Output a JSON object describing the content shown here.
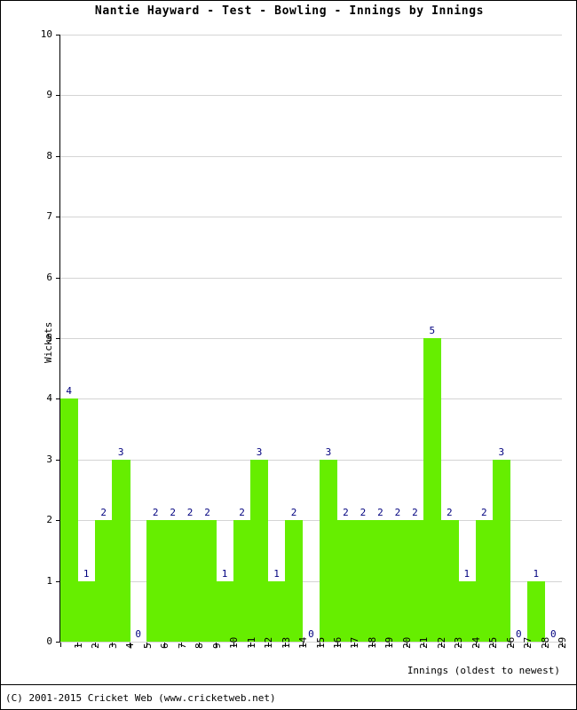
{
  "title": "Nantie Hayward - Test - Bowling - Innings by Innings",
  "footer": "(C) 2001-2015 Cricket Web (www.cricketweb.net)",
  "axes": {
    "x_title": "Innings (oldest to newest)",
    "y_title": "Wickets"
  },
  "colors": {
    "bar": "#66ee00",
    "value_label": "#00007f",
    "gridline": "#d4d4d4",
    "axis": "#000000",
    "background": "#ffffff"
  },
  "chart_data": {
    "type": "bar",
    "title": "Nantie Hayward - Test - Bowling - Innings by Innings",
    "xlabel": "Innings (oldest to newest)",
    "ylabel": "Wickets",
    "ylim": [
      0,
      10
    ],
    "ytick_labels": [
      "0",
      "1",
      "2",
      "3",
      "4",
      "5",
      "6",
      "7",
      "8",
      "9",
      "10"
    ],
    "grid": true,
    "legend": null,
    "categories": [
      "1",
      "2",
      "3",
      "4",
      "5",
      "6",
      "7",
      "8",
      "9",
      "10",
      "11",
      "12",
      "13",
      "14",
      "15",
      "16",
      "17",
      "18",
      "19",
      "20",
      "21",
      "22",
      "23",
      "24",
      "25",
      "26",
      "27",
      "28",
      "29"
    ],
    "values": [
      4,
      1,
      2,
      3,
      0,
      2,
      2,
      2,
      2,
      1,
      2,
      3,
      1,
      2,
      0,
      3,
      2,
      2,
      2,
      2,
      2,
      5,
      2,
      1,
      2,
      3,
      0,
      1,
      0
    ],
    "data_labels": [
      "4",
      "1",
      "2",
      "3",
      "0",
      "2",
      "2",
      "2",
      "2",
      "1",
      "2",
      "3",
      "1",
      "2",
      "0",
      "3",
      "2",
      "2",
      "2",
      "2",
      "2",
      "5",
      "2",
      "1",
      "2",
      "3",
      "0",
      "1",
      "0"
    ]
  }
}
